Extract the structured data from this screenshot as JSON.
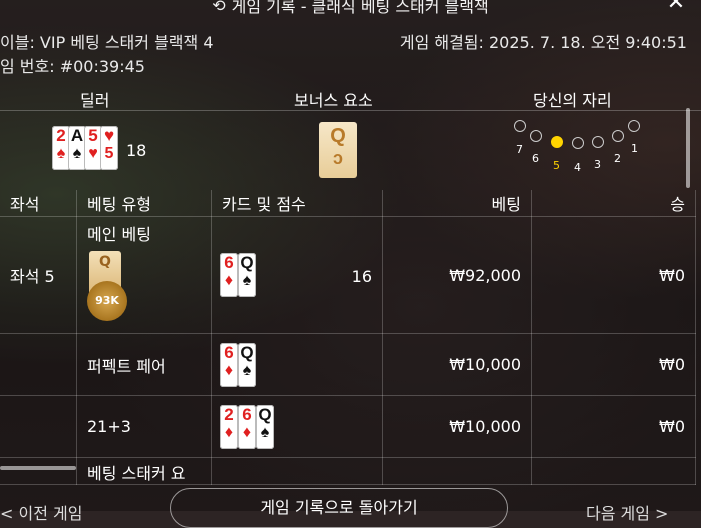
{
  "header": {
    "title": "게임 기록 - 클래식 베팅 스태커 블랙잭",
    "history_icon": "history-icon",
    "close_icon": "close-icon"
  },
  "meta": {
    "table_label": "이블: VIP 베팅 스태커 블랙잭 4",
    "resolved_label": "게임 해결됨: 2025. 7. 18. 오전 9:40:51",
    "game_number_label": "임 번호: #00:39:45"
  },
  "summary": {
    "dealer_header": "딜러",
    "bonus_header": "보너스 요소",
    "seat_header": "당신의 자리",
    "dealer_score": "18",
    "dealer_cards": [
      {
        "rank": "2",
        "suit": "♠",
        "color": "red"
      },
      {
        "rank": "A",
        "suit": "♠",
        "color": "black"
      },
      {
        "rank": "5",
        "suit": "♥",
        "color": "red"
      }
    ],
    "bonus_card": {
      "rank": "Q",
      "suit": "ↄ"
    },
    "seats": [
      {
        "num": "7",
        "active": false
      },
      {
        "num": "6",
        "active": false
      },
      {
        "num": "5",
        "active": true
      },
      {
        "num": "4",
        "active": false
      },
      {
        "num": "3",
        "active": false
      },
      {
        "num": "2",
        "active": false
      },
      {
        "num": "1",
        "active": false
      }
    ]
  },
  "table": {
    "columns": [
      "좌석",
      "베팅 유형",
      "카드 및 점수",
      "베팅",
      "승"
    ],
    "seat_label": "좌석 5",
    "rows": [
      {
        "bet_type": "메인 베팅",
        "score": "16",
        "bet": "₩92,000",
        "win": "₩0",
        "chip_label": "Q",
        "chip_amount": "93K",
        "cards": [
          {
            "rank": "6",
            "suit": "♦",
            "color": "red"
          },
          {
            "rank": "Q",
            "suit": "♠",
            "color": "black"
          }
        ]
      },
      {
        "bet_type": "퍼펙트 페어",
        "score": "",
        "bet": "₩10,000",
        "win": "₩0",
        "cards": [
          {
            "rank": "6",
            "suit": "♦",
            "color": "red"
          },
          {
            "rank": "Q",
            "suit": "♠",
            "color": "black"
          }
        ]
      },
      {
        "bet_type": "21+3",
        "score": "",
        "bet": "₩10,000",
        "win": "₩0",
        "cards": [
          {
            "rank": "2",
            "suit": "♦",
            "color": "red"
          },
          {
            "rank": "6",
            "suit": "♦",
            "color": "red"
          },
          {
            "rank": "Q",
            "suit": "♠",
            "color": "black"
          }
        ]
      }
    ],
    "partial_row_label": "베팅 스태커 요"
  },
  "footer": {
    "prev_label": "< 이전 게임",
    "back_label": "게임 기록으로 돌아가기",
    "next_label": "다음 게임 >"
  }
}
